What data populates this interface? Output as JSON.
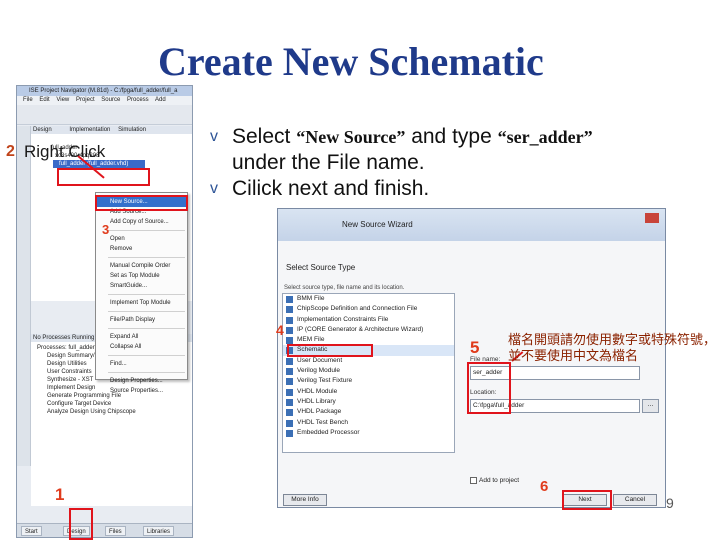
{
  "slide": {
    "title": "Create New Schematic",
    "bullet1_a": "Select ",
    "bullet1_b": "“New Source”",
    "bullet1_c": " and type ",
    "bullet1_d": "“ser_adder”",
    "bullet1_e": "under the File name.",
    "bullet2": "Cilick next and finish.",
    "bullet_mark": "v",
    "page_number": "9",
    "cjk_note": "檔名開頭請勿使用數字或特殊符號，並不要使用中文為檔名"
  },
  "steps": {
    "s1": "1",
    "s2_num": "2",
    "s2_label": "Right Click",
    "s3": "3",
    "s4": "4",
    "s5": "5",
    "s6": "6"
  },
  "ise": {
    "title": "ISE Project Navigator (M.81d) - C:/fpga/full_adder/full_a",
    "menus": [
      "File",
      "Edit",
      "View",
      "Project",
      "Source",
      "Process",
      "Add"
    ],
    "design_pane_title": "Design",
    "impl_label": "Implementation",
    "sim_label": "Simulation",
    "tree": [
      "full_adder",
      "xc3s400-4pq208",
      "full_adder (full_adder.vhd)"
    ],
    "processes_title": "No Processes Running",
    "processes_for": "Processes: full_adder",
    "processes": [
      "Design Summary/Reports",
      "Design Utilities",
      "User Constraints",
      "Synthesize - XST",
      "Implement Design",
      "Generate Programming File",
      "Configure Target Device",
      "Analyze Design Using Chipscope"
    ],
    "tabs": [
      "Start",
      "Design",
      "Files",
      "Libraries"
    ]
  },
  "context_menu": {
    "items": [
      "New Source...",
      "Add Source...",
      "Add Copy of Source...",
      "Open",
      "Remove",
      "Manual Compile Order",
      "Set as Top Module",
      "SmartGuide...",
      "Implement Top Module",
      "File/Path Display",
      "Expand All",
      "Collapse All",
      "Find...",
      "Design Properties...",
      "Source Properties..."
    ]
  },
  "wizard": {
    "title": "New Source Wizard",
    "header": "Select Source Type",
    "subhead": "Select source type, file name and its location.",
    "list": [
      "BMM File",
      "ChipScope Definition and Connection File",
      "Implementation Constraints File",
      "IP (CORE Generator & Architecture Wizard)",
      "MEM File",
      "Schematic",
      "User Document",
      "Verilog Module",
      "Verilog Test Fixture",
      "VHDL Module",
      "VHDL Library",
      "VHDL Package",
      "VHDL Test Bench",
      "Embedded Processor"
    ],
    "file_name_label": "File name:",
    "file_name_value": "ser_adder",
    "location_label": "Location:",
    "location_value": "C:\\fpga\\full_adder",
    "browse": "...",
    "add_to_project": "Add to project",
    "btn_more_info": "More Info",
    "btn_next": "Next",
    "btn_cancel": "Cancel"
  },
  "colors": {
    "title": "#1f3a8a",
    "annotation_red": "#e0141c",
    "step_number": "#e03b1c",
    "cjk_note": "#8b2200"
  }
}
